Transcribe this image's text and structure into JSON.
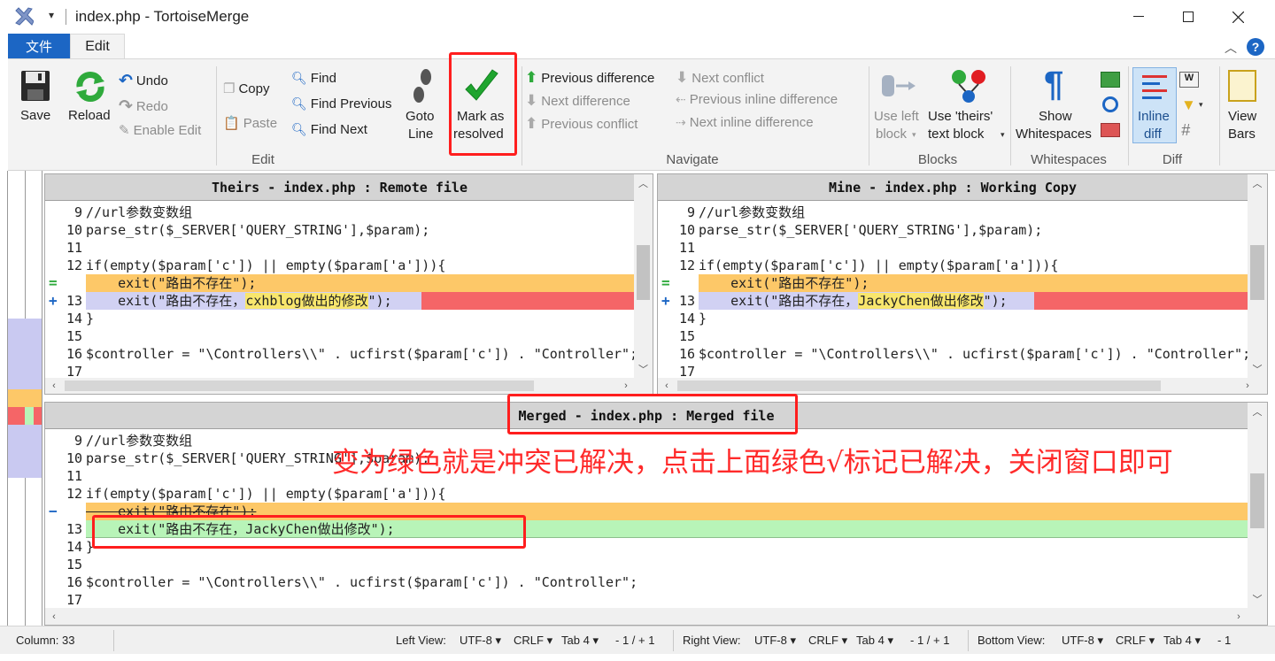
{
  "window": {
    "title": "index.php - TortoiseMerge"
  },
  "tabs": {
    "file": "文件",
    "edit": "Edit"
  },
  "ribbon": {
    "save": "Save",
    "reload": "Reload",
    "undo": "Undo",
    "redo": "Redo",
    "enable_edit": "Enable Edit",
    "copy": "Copy",
    "paste": "Paste",
    "find": "Find",
    "find_previous": "Find Previous",
    "find_next": "Find Next",
    "goto_line_1": "Goto",
    "goto_line_2": "Line",
    "mark_resolved_1": "Mark as",
    "mark_resolved_2": "resolved",
    "prev_diff": "Previous difference",
    "next_diff": "Next difference",
    "prev_conflict": "Previous conflict",
    "next_conflict": "Next conflict",
    "prev_inline": "Previous inline difference",
    "next_inline": "Next inline difference",
    "use_left_1": "Use left",
    "use_left_2": "block",
    "use_theirs_1": "Use 'theirs'",
    "use_theirs_2": "text block",
    "show_ws_1": "Show",
    "show_ws_2": "Whitespaces",
    "inline_diff_1": "Inline",
    "inline_diff_2": "diff",
    "view_bars_1": "View",
    "view_bars_2": "Bars",
    "groups": {
      "edit": "Edit",
      "navigate": "Navigate",
      "blocks": "Blocks",
      "whitespaces": "Whitespaces",
      "diff": "Diff"
    }
  },
  "panes": {
    "theirs": {
      "title": "Theirs - index.php : Remote file"
    },
    "mine": {
      "title": "Mine - index.php : Working Copy"
    },
    "merged": {
      "title": "Merged - index.php : Merged file"
    }
  },
  "code": {
    "l9": "//url参数变数组",
    "l10": "parse_str($_SERVER['QUERY_STRING'],$param);",
    "l12": "if(empty($param['c']) || empty($param['a'])){",
    "l_exit1": "    exit(\"路由不存在\");",
    "l13_theirs_pre": "    exit(\"路由不存在，",
    "l13_theirs_hl": "cxhblog做出的修改",
    "l13_theirs_post": "\");",
    "l13_mine_pre": "    exit(\"路由不存在，",
    "l13_mine_hl": "JackyChen做出修改",
    "l13_mine_post": "\");",
    "l13_merged": "    exit(\"路由不存在，JackyChen做出修改\");",
    "l14": "}",
    "l16": "$controller = \"\\Controllers\\\\\" . ucfirst($param['c']) . \"Controller\";",
    "l16_merged": "$controller = \"\\Controllers\\\\\" . ucfirst($param['c']) . \"Controller\";",
    "l10_merged": "parse_str($_SERVER['QUERY_STRING'],$param);"
  },
  "line_numbers": [
    "9",
    "10",
    "11",
    "12",
    "13",
    "14",
    "15",
    "16",
    "17"
  ],
  "markers": {
    "equal": "=",
    "plus": "+",
    "minus": "−"
  },
  "annotation": {
    "note": "变为绿色就是冲突已解决，点击上面绿色√标记已解决，关闭窗口即可"
  },
  "status": {
    "column": "Column: 33",
    "left_view": "Left View:",
    "right_view": "Right View:",
    "bottom_view": "Bottom View:",
    "encoding": "UTF-8",
    "eol": "CRLF",
    "tab": "Tab 4",
    "left_counts": "- 1 / + 1",
    "right_counts": "- 1 / + 1",
    "bottom_counts": "- 1"
  },
  "colors": {
    "conflict_orange": "#fdc868",
    "added_blue": "#d1d1f3",
    "removed_red": "#f56567",
    "resolved_green": "#b8f4b8",
    "accent_blue": "#1c66c4"
  }
}
